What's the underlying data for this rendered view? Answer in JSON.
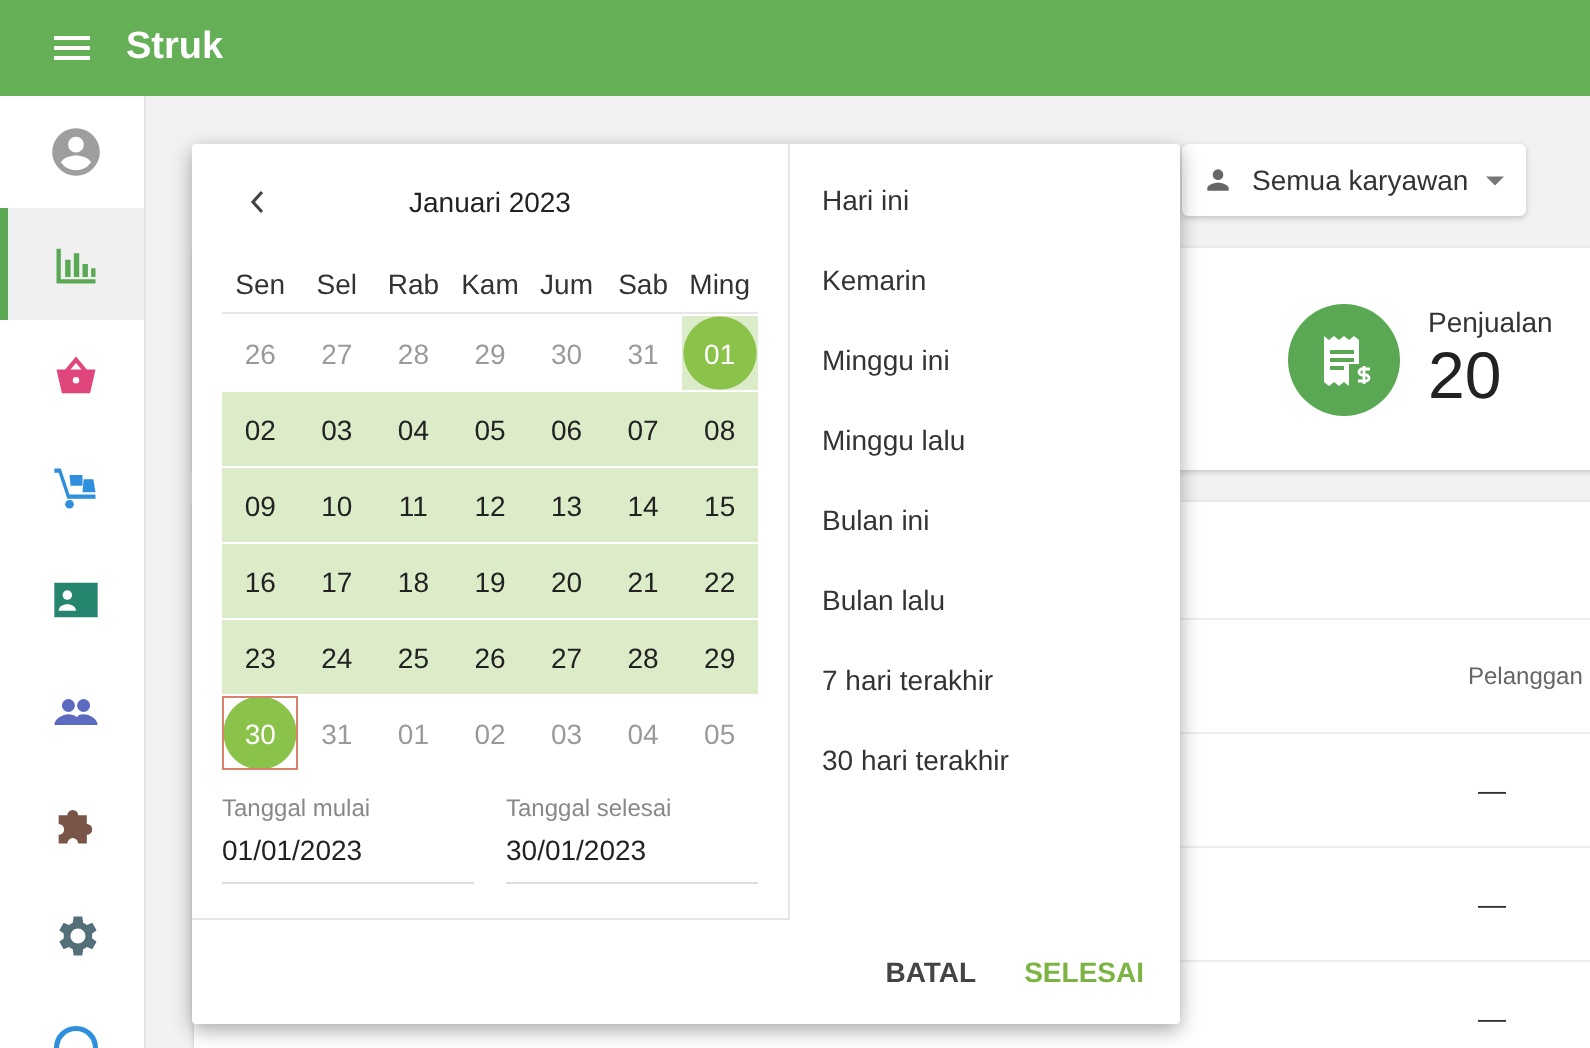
{
  "app_bar": {
    "title": "Struk"
  },
  "sidebar": {
    "items": [
      {
        "selected": false,
        "color": "#9e9e9e"
      },
      {
        "selected": true,
        "color": "#5aa854"
      },
      {
        "selected": false,
        "color": "#e0457b"
      },
      {
        "selected": false,
        "color": "#2f8fdc"
      },
      {
        "selected": false,
        "color": "#26856f"
      },
      {
        "selected": false,
        "color": "#5c6bc0"
      },
      {
        "selected": false,
        "color": "#795548"
      },
      {
        "selected": false,
        "color": "#546e7a"
      },
      {
        "selected": false,
        "color": "#2f8fdc"
      }
    ]
  },
  "employee_filter": {
    "label": "Semua karyawan"
  },
  "summary": {
    "label": "Penjualan",
    "value": "20"
  },
  "table": {
    "columns": [
      "Pelanggan"
    ],
    "rows": [
      [
        "—"
      ],
      [
        "—"
      ],
      [
        "—"
      ]
    ]
  },
  "date_picker": {
    "month_label": "Januari 2023",
    "weekdays": [
      "Sen",
      "Sel",
      "Rab",
      "Kam",
      "Jum",
      "Sab",
      "Ming"
    ],
    "weeks": [
      [
        {
          "label": "26",
          "outside": true,
          "in_range": false,
          "selected": false,
          "focused": false
        },
        {
          "label": "27",
          "outside": true,
          "in_range": false,
          "selected": false,
          "focused": false
        },
        {
          "label": "28",
          "outside": true,
          "in_range": false,
          "selected": false,
          "focused": false
        },
        {
          "label": "29",
          "outside": true,
          "in_range": false,
          "selected": false,
          "focused": false
        },
        {
          "label": "30",
          "outside": true,
          "in_range": false,
          "selected": false,
          "focused": false
        },
        {
          "label": "31",
          "outside": true,
          "in_range": false,
          "selected": false,
          "focused": false
        },
        {
          "label": "01",
          "outside": false,
          "in_range": true,
          "selected": true,
          "focused": false
        }
      ],
      [
        {
          "label": "02",
          "outside": false,
          "in_range": true,
          "selected": false,
          "focused": false
        },
        {
          "label": "03",
          "outside": false,
          "in_range": true,
          "selected": false,
          "focused": false
        },
        {
          "label": "04",
          "outside": false,
          "in_range": true,
          "selected": false,
          "focused": false
        },
        {
          "label": "05",
          "outside": false,
          "in_range": true,
          "selected": false,
          "focused": false
        },
        {
          "label": "06",
          "outside": false,
          "in_range": true,
          "selected": false,
          "focused": false
        },
        {
          "label": "07",
          "outside": false,
          "in_range": true,
          "selected": false,
          "focused": false
        },
        {
          "label": "08",
          "outside": false,
          "in_range": true,
          "selected": false,
          "focused": false
        }
      ],
      [
        {
          "label": "09",
          "outside": false,
          "in_range": true,
          "selected": false,
          "focused": false
        },
        {
          "label": "10",
          "outside": false,
          "in_range": true,
          "selected": false,
          "focused": false
        },
        {
          "label": "11",
          "outside": false,
          "in_range": true,
          "selected": false,
          "focused": false
        },
        {
          "label": "12",
          "outside": false,
          "in_range": true,
          "selected": false,
          "focused": false
        },
        {
          "label": "13",
          "outside": false,
          "in_range": true,
          "selected": false,
          "focused": false
        },
        {
          "label": "14",
          "outside": false,
          "in_range": true,
          "selected": false,
          "focused": false
        },
        {
          "label": "15",
          "outside": false,
          "in_range": true,
          "selected": false,
          "focused": false
        }
      ],
      [
        {
          "label": "16",
          "outside": false,
          "in_range": true,
          "selected": false,
          "focused": false
        },
        {
          "label": "17",
          "outside": false,
          "in_range": true,
          "selected": false,
          "focused": false
        },
        {
          "label": "18",
          "outside": false,
          "in_range": true,
          "selected": false,
          "focused": false
        },
        {
          "label": "19",
          "outside": false,
          "in_range": true,
          "selected": false,
          "focused": false
        },
        {
          "label": "20",
          "outside": false,
          "in_range": true,
          "selected": false,
          "focused": false
        },
        {
          "label": "21",
          "outside": false,
          "in_range": true,
          "selected": false,
          "focused": false
        },
        {
          "label": "22",
          "outside": false,
          "in_range": true,
          "selected": false,
          "focused": false
        }
      ],
      [
        {
          "label": "23",
          "outside": false,
          "in_range": true,
          "selected": false,
          "focused": false
        },
        {
          "label": "24",
          "outside": false,
          "in_range": true,
          "selected": false,
          "focused": false
        },
        {
          "label": "25",
          "outside": false,
          "in_range": true,
          "selected": false,
          "focused": false
        },
        {
          "label": "26",
          "outside": false,
          "in_range": true,
          "selected": false,
          "focused": false
        },
        {
          "label": "27",
          "outside": false,
          "in_range": true,
          "selected": false,
          "focused": false
        },
        {
          "label": "28",
          "outside": false,
          "in_range": true,
          "selected": false,
          "focused": false
        },
        {
          "label": "29",
          "outside": false,
          "in_range": true,
          "selected": false,
          "focused": false
        }
      ],
      [
        {
          "label": "30",
          "outside": false,
          "in_range": false,
          "selected": true,
          "focused": true
        },
        {
          "label": "31",
          "outside": true,
          "in_range": false,
          "selected": false,
          "focused": false
        },
        {
          "label": "01",
          "outside": true,
          "in_range": false,
          "selected": false,
          "focused": false
        },
        {
          "label": "02",
          "outside": true,
          "in_range": false,
          "selected": false,
          "focused": false
        },
        {
          "label": "03",
          "outside": true,
          "in_range": false,
          "selected": false,
          "focused": false
        },
        {
          "label": "04",
          "outside": true,
          "in_range": false,
          "selected": false,
          "focused": false
        },
        {
          "label": "05",
          "outside": true,
          "in_range": false,
          "selected": false,
          "focused": false
        }
      ]
    ],
    "start_field": {
      "label": "Tanggal mulai",
      "value": "01/01/2023"
    },
    "end_field": {
      "label": "Tanggal selesai",
      "value": "30/01/2023"
    },
    "presets": [
      "Hari ini",
      "Kemarin",
      "Minggu ini",
      "Minggu lalu",
      "Bulan ini",
      "Bulan lalu",
      "7 hari terakhir",
      "30 hari terakhir"
    ],
    "buttons": [
      {
        "label": "BATAL",
        "kind": "cancel"
      },
      {
        "label": "SELESAI",
        "kind": "confirm"
      }
    ]
  }
}
